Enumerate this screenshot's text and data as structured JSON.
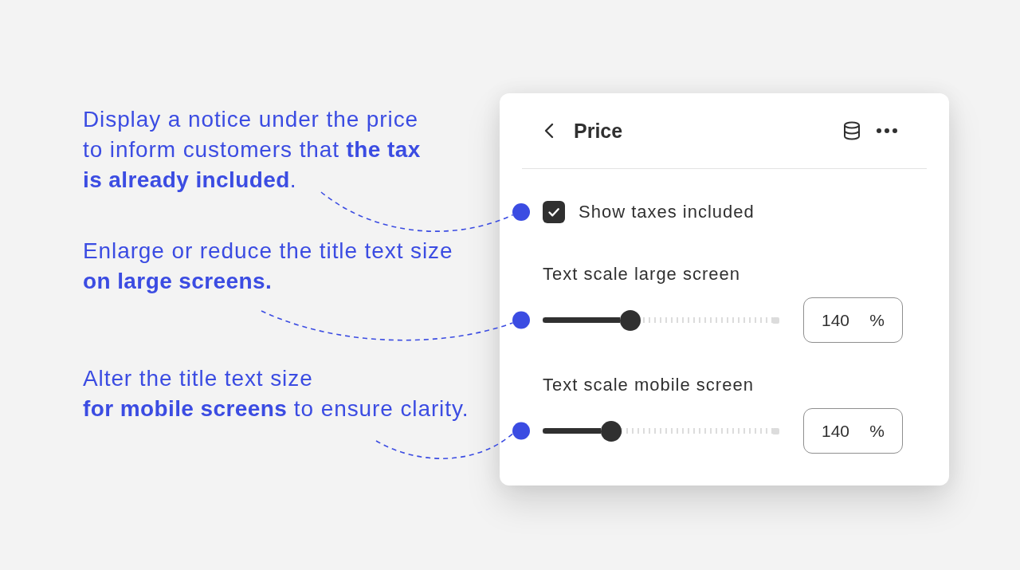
{
  "callouts": [
    {
      "lines": [
        "Display a notice under the price",
        "to inform customers that **the tax**",
        "**is already included**."
      ]
    },
    {
      "lines": [
        "Enlarge or reduce the title text size",
        "**on large screens.**"
      ]
    },
    {
      "lines": [
        "Alter the title text size",
        "**for mobile screens** to ensure clarity."
      ]
    }
  ],
  "panel": {
    "title": "Price",
    "settings": [
      {
        "kind": "checkbox",
        "label": "Show taxes included",
        "checked": true
      },
      {
        "kind": "slider",
        "label": "Text scale large screen",
        "level": 0.37,
        "value": "140",
        "unit": "%"
      },
      {
        "kind": "slider",
        "label": "Text scale mobile screen",
        "level": 0.29,
        "value": "140",
        "unit": "%"
      }
    ]
  }
}
